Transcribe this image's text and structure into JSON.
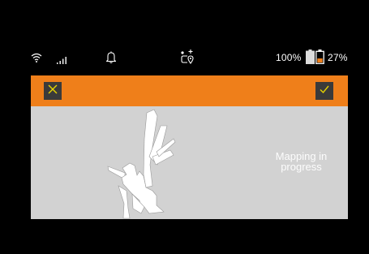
{
  "status_bar": {
    "icons": [
      "wifi-icon",
      "cellular-signal-icon",
      "bell-icon",
      "robot-location-icon",
      "battery-icon"
    ],
    "battery_1": {
      "label": "100%",
      "level": 1.0
    },
    "battery_2": {
      "label": "27%",
      "level": 0.27
    }
  },
  "header": {
    "cancel_icon": "close-icon",
    "confirm_icon": "checkmark-icon",
    "accent_color": "#ef7f1a",
    "icon_color": "#e6d200"
  },
  "map": {
    "status_message": "Mapping in\nprogress",
    "background_color": "#d2d2d2"
  }
}
